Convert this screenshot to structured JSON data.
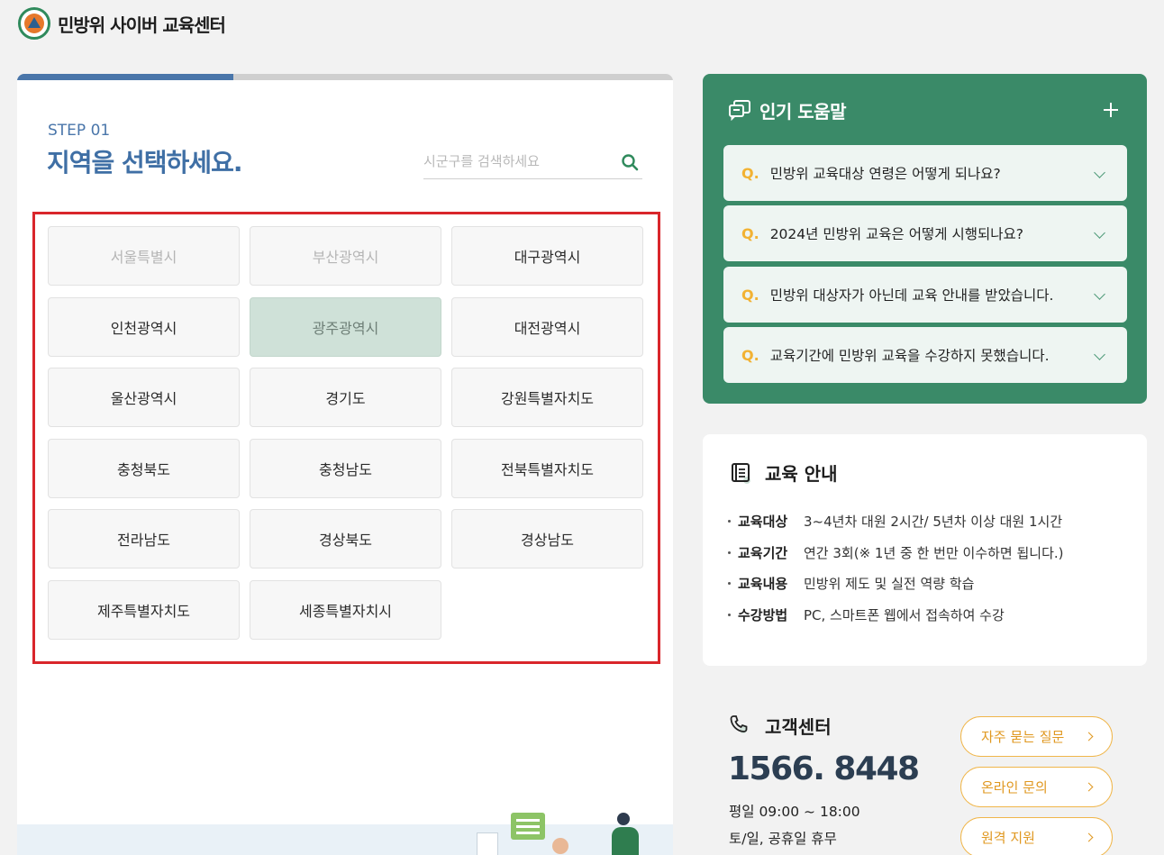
{
  "header": {
    "site_title": "민방위 사이버 교육센터"
  },
  "step": {
    "label": "STEP 01",
    "title": "지역을 선택하세요.",
    "progress": 0.33
  },
  "search": {
    "placeholder": "시군구를 검색하세요",
    "value": ""
  },
  "regions": [
    {
      "label": "서울특별시",
      "state": "disabled"
    },
    {
      "label": "부산광역시",
      "state": "disabled"
    },
    {
      "label": "대구광역시",
      "state": "normal"
    },
    {
      "label": "인천광역시",
      "state": "normal"
    },
    {
      "label": "광주광역시",
      "state": "selected"
    },
    {
      "label": "대전광역시",
      "state": "normal"
    },
    {
      "label": "울산광역시",
      "state": "normal"
    },
    {
      "label": "경기도",
      "state": "normal"
    },
    {
      "label": "강원특별자치도",
      "state": "normal"
    },
    {
      "label": "충청북도",
      "state": "normal"
    },
    {
      "label": "충청남도",
      "state": "normal"
    },
    {
      "label": "전북특별자치도",
      "state": "normal"
    },
    {
      "label": "전라남도",
      "state": "normal"
    },
    {
      "label": "경상북도",
      "state": "normal"
    },
    {
      "label": "경상남도",
      "state": "normal"
    },
    {
      "label": "제주특별자치도",
      "state": "normal"
    },
    {
      "label": "세종특별자치시",
      "state": "normal"
    }
  ],
  "help": {
    "title": "인기 도움말",
    "q_marker": "Q.",
    "faqs": [
      {
        "text": "민방위 교육대상 연령은 어떻게 되나요?"
      },
      {
        "text": "2024년 민방위 교육은 어떻게 시행되나요?"
      },
      {
        "text": "민방위 대상자가 아닌데 교육 안내를 받았습니다."
      },
      {
        "text": "교육기간에 민방위 교육을 수강하지 못했습니다."
      }
    ]
  },
  "edu": {
    "title": "교육 안내",
    "items": [
      {
        "label": "교육대상",
        "value": "3~4년차 대원 2시간/ 5년차 이상 대원 1시간"
      },
      {
        "label": "교육기간",
        "value": "연간 3회(※ 1년 중 한 번만 이수하면 됩니다.)"
      },
      {
        "label": "교육내용",
        "value": "민방위 제도 및 실전 역량 학습"
      },
      {
        "label": "수강방법",
        "value": "PC, 스마트폰 웹에서 접속하여 수강"
      }
    ]
  },
  "customer_center": {
    "title": "고객센터",
    "phone": "1566. 8448",
    "hours_weekday": "평일 09:00 ~ 18:00",
    "hours_weekend": "토/일, 공휴일 휴무",
    "buttons": [
      {
        "label": "자주 묻는 질문"
      },
      {
        "label": "온라인 문의"
      },
      {
        "label": "원격 지원"
      }
    ]
  },
  "colors": {
    "brand_blue": "#3f6fa5",
    "help_green": "#3a8a68",
    "accent_orange": "#e09820",
    "highlight_red": "#d9262b"
  }
}
